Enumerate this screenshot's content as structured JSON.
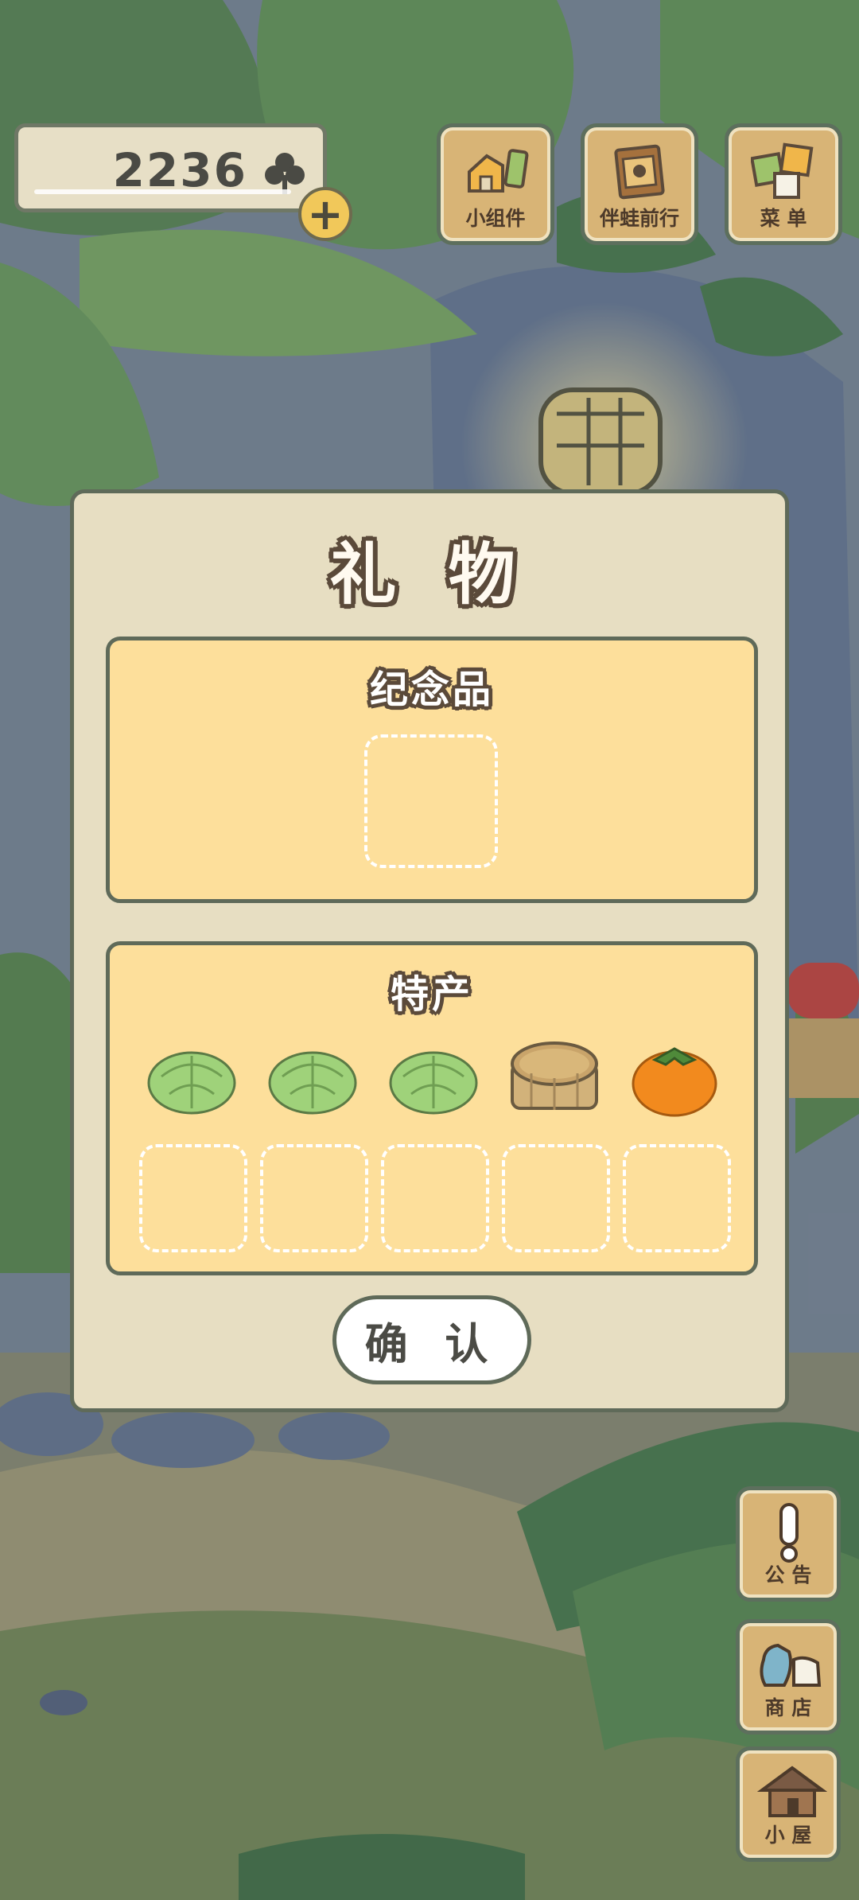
{
  "currency": {
    "amount": "2236",
    "icon": "clover-icon"
  },
  "top_buttons": [
    {
      "label": "小组件",
      "icon": "widget-icon"
    },
    {
      "label": "伴蛙前行",
      "icon": "album-icon"
    },
    {
      "label": "菜 单",
      "icon": "menu-icon"
    }
  ],
  "side_buttons": [
    {
      "label": "公 告",
      "icon": "exclamation-icon"
    },
    {
      "label": "商 店",
      "icon": "shop-bag-icon"
    },
    {
      "label": "小 屋",
      "icon": "house-icon"
    }
  ],
  "dialog": {
    "title": "礼 物",
    "souvenir": {
      "title": "纪念品"
    },
    "specialty": {
      "title": "特产",
      "items": [
        "cabbage-icon",
        "cabbage-icon",
        "cabbage-icon",
        "natto-tub-icon",
        "persimmon-icon"
      ]
    },
    "confirm_label": "确 认"
  },
  "colors": {
    "panel": "#fddf9b",
    "dialog": "#e7dec2",
    "border": "#5f6a59",
    "tile": "#d8b476"
  }
}
